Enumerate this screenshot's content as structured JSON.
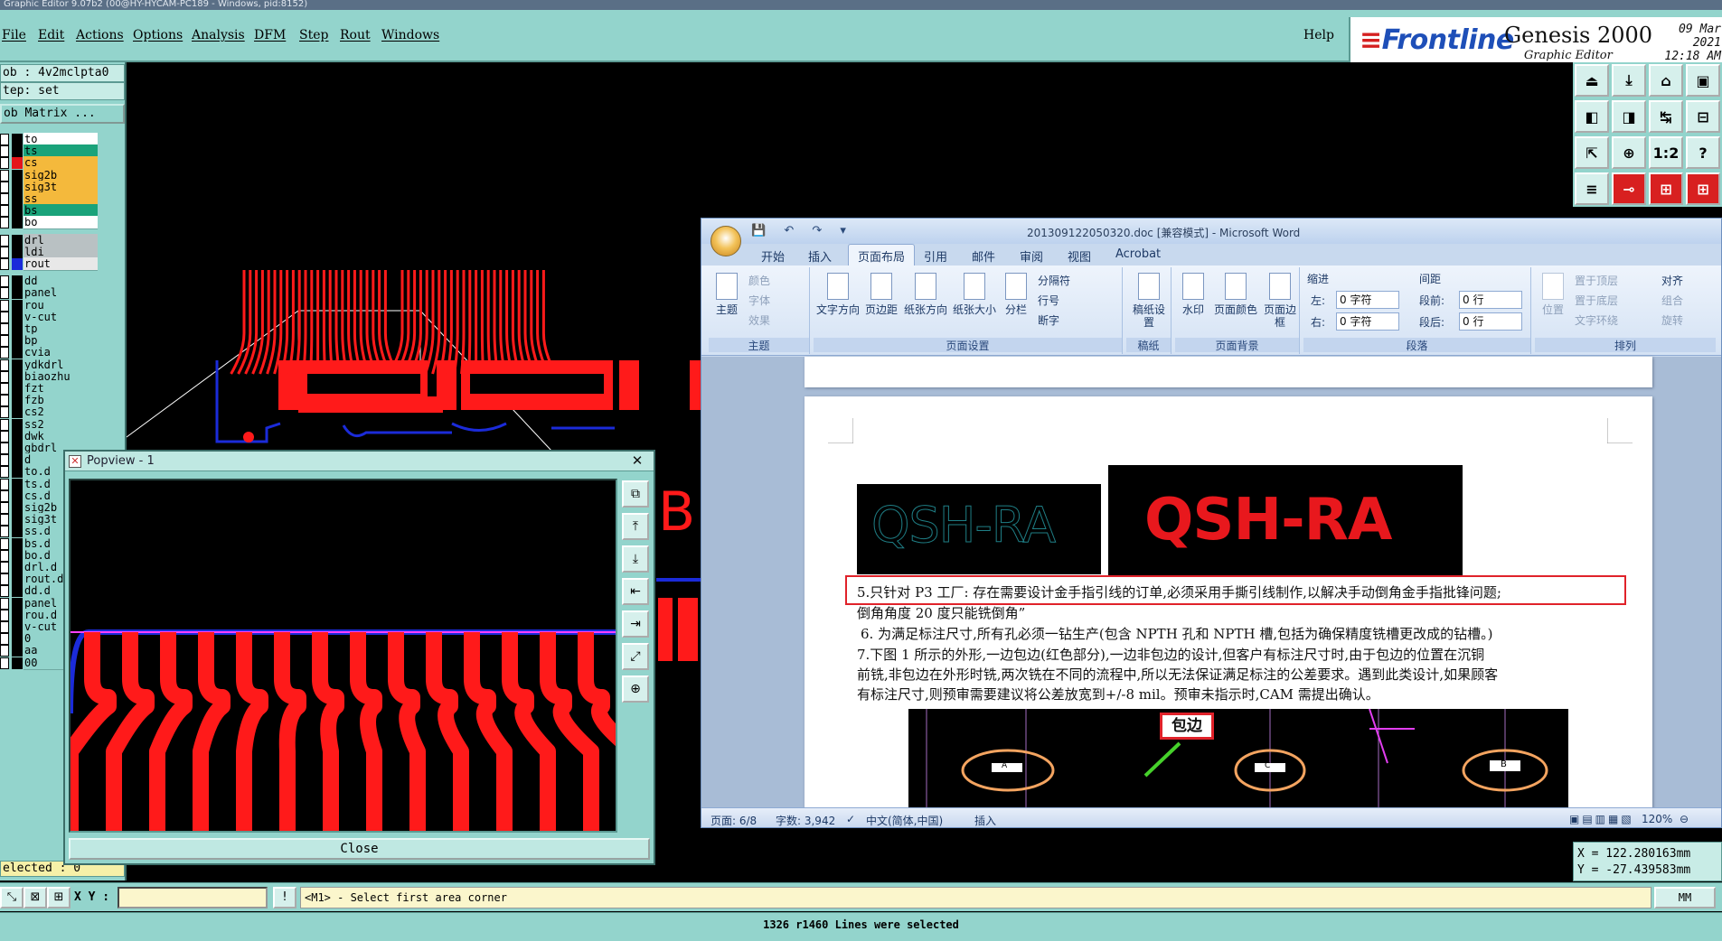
{
  "window": {
    "title": "Graphic Editor 9.07b2 (00@HY-HYCAM-PC189 - Windows, pid:8152)"
  },
  "menu": {
    "items": [
      "File",
      "Edit",
      "Actions",
      "Options",
      "Analysis",
      "DFM",
      "Step",
      "Rout",
      "Windows"
    ],
    "help": "Help"
  },
  "brand": {
    "frontline": "Frontline",
    "product": "Genesis 2000",
    "subtitle": "Graphic Editor",
    "date": "09 Mar 2021",
    "time": "12:18 AM"
  },
  "left": {
    "job": "ob : 4v2mclpta0",
    "step": "tep: set",
    "job_matrix": "ob Matrix ...",
    "selected": "elected : 0",
    "layers": [
      {
        "name": "to",
        "bg": "#ffffff",
        "swatch": "#000000"
      },
      {
        "name": "ts",
        "bg": "#1aa37a",
        "swatch": "#000000"
      },
      {
        "name": "cs",
        "bg": "#f4b93c",
        "swatch": "#e5141a"
      },
      {
        "name": "sig2b",
        "bg": "#f4b93c",
        "swatch": "#000000"
      },
      {
        "name": "sig3t",
        "bg": "#f4b93c",
        "swatch": "#000000"
      },
      {
        "name": "ss",
        "bg": "#f4b93c",
        "swatch": "#000000"
      },
      {
        "name": "bs",
        "bg": "#1aa37a",
        "swatch": "#000000"
      },
      {
        "name": "bo",
        "bg": "#ffffff",
        "swatch": "#000000"
      },
      {
        "name": "drl",
        "bg": "#b9c1c3",
        "swatch": "#000000"
      },
      {
        "name": "ldi",
        "bg": "#b9c1c3",
        "swatch": "#000000"
      },
      {
        "name": "rout",
        "bg": "#e8e8e8",
        "swatch": "#1b2bd9"
      },
      {
        "name": "dd",
        "bg": "#93d4cc",
        "swatch": "#000000"
      },
      {
        "name": "panel",
        "bg": "#93d4cc",
        "swatch": "#000000"
      },
      {
        "name": "rou",
        "bg": "#93d4cc",
        "swatch": "#000000"
      },
      {
        "name": "v-cut",
        "bg": "#93d4cc",
        "swatch": "#000000"
      },
      {
        "name": "tp",
        "bg": "#93d4cc",
        "swatch": "#000000"
      },
      {
        "name": "bp",
        "bg": "#93d4cc",
        "swatch": "#000000"
      },
      {
        "name": "cvia",
        "bg": "#93d4cc",
        "swatch": "#000000"
      },
      {
        "name": "ydkdrl",
        "bg": "#93d4cc",
        "swatch": "#000000"
      },
      {
        "name": "biaozhu",
        "bg": "#93d4cc",
        "swatch": "#000000"
      },
      {
        "name": "fzt",
        "bg": "#93d4cc",
        "swatch": "#000000"
      },
      {
        "name": "fzb",
        "bg": "#93d4cc",
        "swatch": "#000000"
      },
      {
        "name": "cs2",
        "bg": "#93d4cc",
        "swatch": "#000000"
      },
      {
        "name": "ss2",
        "bg": "#93d4cc",
        "swatch": "#000000"
      },
      {
        "name": "dwk",
        "bg": "#93d4cc",
        "swatch": "#000000"
      },
      {
        "name": "gbdrl",
        "bg": "#93d4cc",
        "swatch": "#000000"
      },
      {
        "name": "d",
        "bg": "#93d4cc",
        "swatch": "#000000"
      },
      {
        "name": "to.d",
        "bg": "#93d4cc",
        "swatch": "#000000"
      },
      {
        "name": "ts.d",
        "bg": "#93d4cc",
        "swatch": "#000000"
      },
      {
        "name": "cs.d",
        "bg": "#93d4cc",
        "swatch": "#000000"
      },
      {
        "name": "sig2b",
        "bg": "#93d4cc",
        "swatch": "#000000"
      },
      {
        "name": "sig3t",
        "bg": "#93d4cc",
        "swatch": "#000000"
      },
      {
        "name": "ss.d",
        "bg": "#93d4cc",
        "swatch": "#000000"
      },
      {
        "name": "bs.d",
        "bg": "#93d4cc",
        "swatch": "#000000"
      },
      {
        "name": "bo.d",
        "bg": "#93d4cc",
        "swatch": "#000000"
      },
      {
        "name": "drl.d",
        "bg": "#93d4cc",
        "swatch": "#000000"
      },
      {
        "name": "rout.d",
        "bg": "#93d4cc",
        "swatch": "#000000"
      },
      {
        "name": "dd.d",
        "bg": "#93d4cc",
        "swatch": "#000000"
      },
      {
        "name": "panel",
        "bg": "#93d4cc",
        "swatch": "#000000"
      },
      {
        "name": "rou.d",
        "bg": "#93d4cc",
        "swatch": "#000000"
      },
      {
        "name": "v-cut",
        "bg": "#93d4cc",
        "swatch": "#000000"
      },
      {
        "name": "0",
        "bg": "#93d4cc",
        "swatch": "#000000"
      },
      {
        "name": "aa",
        "bg": "#93d4cc",
        "swatch": "#000000"
      },
      {
        "name": "00",
        "bg": "#93d4cc",
        "swatch": "#000000"
      }
    ]
  },
  "tools": {
    "labels": [
      "⏏",
      "⤓",
      "⌂",
      "▣",
      "◧",
      "◨",
      "↹",
      "⊟",
      "⇱",
      "⊕",
      "1:2",
      "?",
      "≡",
      "⊸",
      "⊞",
      "⊞"
    ]
  },
  "canvas": {
    "letter": "B"
  },
  "popview": {
    "title": "Popview - 1",
    "close_x": "✕",
    "close_label": "Close",
    "tool_labels": [
      "⧉",
      "⤒",
      "⤓",
      "⇤",
      "⇥",
      "⤢",
      "⊕"
    ]
  },
  "word": {
    "title": "201309122050320.doc [兼容模式] - Microsoft Word",
    "qat": "💾 ↶ ↷ ▾",
    "tabs": [
      "开始",
      "插入",
      "页面布局",
      "引用",
      "邮件",
      "审阅",
      "视图",
      "Acrobat"
    ],
    "ribbon": {
      "theme_group": "主题",
      "theme_btn": "主题",
      "theme_colors": "颜色",
      "theme_fonts": "字体",
      "theme_effects": "效果",
      "page_setup_group": "页面设置",
      "text_direction": "文字方向",
      "margins": "页边距",
      "orientation": "纸张方向",
      "size": "纸张大小",
      "columns": "分栏",
      "breaks": "分隔符",
      "line_numbers": "行号",
      "hyphenation": "断字",
      "draft_group": "稿纸",
      "draft_btn": "稿纸设置",
      "background_group": "页面背景",
      "watermark": "水印",
      "page_color": "页面颜色",
      "page_borders": "页面边框",
      "paragraph_group": "段落",
      "indent": "缩进",
      "indent_left_label": "左:",
      "indent_left": "0 字符",
      "indent_right_label": "右:",
      "indent_right": "0 字符",
      "spacing": "间距",
      "spacing_before_label": "段前:",
      "spacing_before": "0 行",
      "spacing_after_label": "段后:",
      "spacing_after": "0 行",
      "arrange_group": "排列",
      "position": "位置",
      "bring_front": "置于顶层",
      "send_back": "置于底层",
      "text_wrap": "文字环绕",
      "align": "对齐",
      "group": "组合",
      "rotate": "旋转"
    },
    "doc": {
      "img1_text": "QSH-RA",
      "img2_text": "QSH-RA",
      "line5a": "5.只针对 P3 工厂:   存在需要设计金手指引线的订单,必须采用手撕引线制作,以解决手动倒角金手指批锋问题;",
      "line5b": "倒角角度 20 度只能铣倒角”",
      "line6": "6. 为满足标注尺寸,所有孔必须一钻生产(包含 NPTH 孔和 NPTH 槽,包括为确保精度铣槽更改成的钻槽。)",
      "line7a": "7.下图 1 所示的外形,一边包边(红色部分),一边非包边的设计,但客户有标注尺寸时,由于包边的位置在沉铜",
      "line7b": "前铣,非包边在外形时铣,两次铣在不同的流程中,所以无法保证满足标注的公差要求。遇到此类设计,如果顾客",
      "line7c": "有标注尺寸,则预审需要建议将公差放宽到+/-8 mil。预审未指示时,CAM 需提出确认。",
      "diagram_label": "包边",
      "diagram_marks": [
        "A",
        "C",
        "B"
      ]
    },
    "status": {
      "page": "页面: 6/8",
      "words": "字数: 3,942",
      "lang": "中文(简体,中国)",
      "insert": "插入",
      "zoom": "120%"
    }
  },
  "coords": {
    "x": "X = 122.280163mm",
    "y": "Y = -27.439583mm"
  },
  "command": {
    "xy_label": "X Y :",
    "xy_value": "",
    "prompt": "<M1> - Select first area corner",
    "units": "MM",
    "icon_labels": [
      "⤡",
      "⊠",
      "⊞"
    ],
    "alert_label": "!"
  },
  "status": {
    "message": "1326 r1460 Lines were selected"
  },
  "colors": {
    "panel": "#93d4cc",
    "copper": "#ff1a1a",
    "rout": "#1b2bd9",
    "highlight": "#e0222a",
    "trace_highlight": "#ff40ff"
  }
}
